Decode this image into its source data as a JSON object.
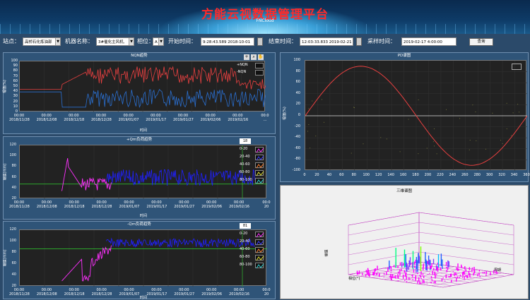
{
  "header": {
    "title": "方能云视数据管理平台",
    "subtitle": "FNCloud"
  },
  "toolbar": {
    "site_label": "站点：",
    "site_value": "高桥石化炼油部",
    "machine_label": "机器名称：",
    "machine_value": "3#催化主风机,",
    "phase_label": "相位：",
    "phase_value": "A",
    "start_label": "开始时间：",
    "start_value": "9:28:43.589 2018-10-01",
    "end_label": "结束时间：",
    "end_value": "12:03:33.833 2019-02-21",
    "sample_label": "采样时间：",
    "sample_value": "2019-02-17 4:00:00",
    "query_label": "查询"
  },
  "colors": {
    "red": "#e84040",
    "blue": "#2a6fd0",
    "magenta": "#ff30ff",
    "navy": "#2020ff",
    "green": "#30d030"
  },
  "icons": [
    "plus-icon",
    "magnifier-icon",
    "hand-icon"
  ],
  "nqn": {
    "title": "NQN趋势",
    "legend": [
      "+NQN",
      "-NQN"
    ],
    "ylabel": "幅值(%)",
    "xlabel": "时间",
    "yticks": [
      "100",
      "90",
      "80",
      "70",
      "60",
      "50",
      "40",
      "30",
      "20",
      "10",
      "0"
    ],
    "xticks": [
      [
        "00:00",
        "2018/11/28"
      ],
      [
        "00:00",
        "2018/12/08"
      ],
      [
        "00:00",
        "2018/12/18"
      ],
      [
        "00:00",
        "2018/12/28"
      ],
      [
        "00:00",
        "2019/01/07"
      ],
      [
        "00:00",
        "2019/01/17"
      ],
      [
        "00:00",
        "2019/01/27"
      ],
      [
        "00:00",
        "2019/02/06"
      ],
      [
        "00:00",
        "2019/02/16"
      ],
      [
        "00:0",
        "..."
      ]
    ]
  },
  "qplus": {
    "title": "+Qm负荷趋势",
    "num": "18",
    "legend": [
      "0-20",
      "20-40",
      "40-60",
      "60-80",
      "80-100"
    ],
    "ylabel": "幅值(mm)",
    "xlabel": "时间",
    "yticks": [
      "120",
      "100",
      "80",
      "60",
      "40",
      "20"
    ],
    "xticks": [
      [
        "00:00",
        "2018/11/28"
      ],
      [
        "00:00",
        "2018/12/08"
      ],
      [
        "00:00",
        "2018/12/18"
      ],
      [
        "00:00",
        "2018/12/28"
      ],
      [
        "00:00",
        "2019/01/07"
      ],
      [
        "00:00",
        "2019/01/17"
      ],
      [
        "00:00",
        "2019/01/27"
      ],
      [
        "00:00",
        "2019/02/06"
      ],
      [
        "00:00",
        "2019/02/16"
      ],
      [
        "00:0",
        "20"
      ]
    ]
  },
  "qminus": {
    "title": "-Qm负荷趋势",
    "num": "81",
    "legend": [
      "0-20",
      "20-40",
      "40-60",
      "60-80",
      "80-100"
    ],
    "ylabel": "幅值(mm)",
    "xlabel": "时间",
    "yticks": [
      "120",
      "100",
      "80",
      "60",
      "40",
      "20"
    ],
    "xticks": [
      [
        "00:00",
        "2018/11/28"
      ],
      [
        "00:00",
        "2018/12/08"
      ],
      [
        "00:00",
        "2018/12/18"
      ],
      [
        "00:00",
        "2018/12/28"
      ],
      [
        "00:00",
        "2019/01/07"
      ],
      [
        "00:00",
        "2019/01/17"
      ],
      [
        "00:00",
        "2019/01/27"
      ],
      [
        "00:00",
        "2019/02/06"
      ],
      [
        "00:00",
        "2019/02/16"
      ],
      [
        "00:0",
        "20"
      ]
    ]
  },
  "prpd": {
    "title": "PD谱图",
    "ylabel": "幅值(%)",
    "yticks": [
      "100",
      "80",
      "60",
      "40",
      "20",
      "0",
      "-20",
      "-40",
      "-60",
      "-80",
      "-100"
    ],
    "xticks": [
      "0",
      "20",
      "40",
      "60",
      "80",
      "100",
      "120",
      "140",
      "160",
      "180",
      "200",
      "220",
      "240",
      "260",
      "280",
      "300",
      "320",
      "340",
      "360"
    ]
  },
  "p3d": {
    "title": "三维谱图",
    "zlabel": "幅值",
    "xlabel": "相位(°)",
    "ylabel": "周期"
  }
}
